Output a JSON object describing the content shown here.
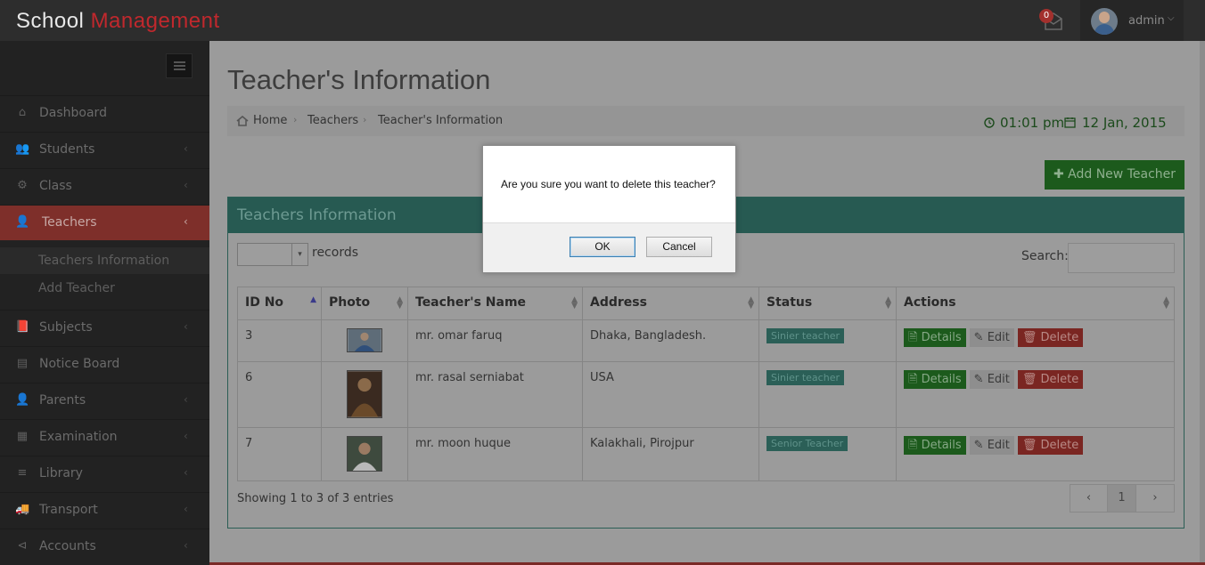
{
  "brand": {
    "part1": "School ",
    "part2": "Management"
  },
  "topbar": {
    "mail_count": "0",
    "user_name": "admin",
    "caret": "⌵"
  },
  "sidebar": {
    "items": [
      {
        "label": "Dashboard",
        "icon": "⌂"
      },
      {
        "label": "Students",
        "icon": "👥"
      },
      {
        "label": "Class",
        "icon": "⚙"
      },
      {
        "label": "Teachers",
        "icon": "👤"
      },
      {
        "label": "Subjects",
        "icon": "📕"
      },
      {
        "label": "Notice Board",
        "icon": "▤"
      },
      {
        "label": "Parents",
        "icon": "👤"
      },
      {
        "label": "Examination",
        "icon": "▦"
      },
      {
        "label": "Library",
        "icon": "≡"
      },
      {
        "label": "Transport",
        "icon": "🚚"
      },
      {
        "label": "Accounts",
        "icon": "⊲"
      }
    ],
    "subitems": [
      {
        "label": "Teachers Information"
      },
      {
        "label": "Add Teacher"
      }
    ],
    "chevron": "‹"
  },
  "page": {
    "title": "Teacher's Information",
    "breadcrumb": [
      "Home",
      "Teachers",
      "Teacher's Information"
    ],
    "time": "01:01 pm",
    "date": "12 Jan, 2015",
    "add_button": "Add New Teacher"
  },
  "panel": {
    "title": "Teachers Information",
    "records_label": "records",
    "search_label": "Search:",
    "columns": [
      "ID No",
      "Photo",
      "Teacher's Name",
      "Address",
      "Status",
      "Actions"
    ],
    "rows": [
      {
        "id": "3",
        "name": "mr. omar faruq",
        "address": "Dhaka, Bangladesh.",
        "status": "Sinier teacher"
      },
      {
        "id": "6",
        "name": "mr. rasal serniabat",
        "address": "USA",
        "status": "Sinier teacher"
      },
      {
        "id": "7",
        "name": "mr. moon huque",
        "address": "Kalakhali, Pirojpur",
        "status": "Senior Teacher"
      }
    ],
    "actions": {
      "details": "Details",
      "edit": "Edit",
      "delete": "Delete"
    },
    "showing": "Showing 1 to 3 of 3 entries",
    "pager": {
      "prev": "‹",
      "page": "1",
      "next": "›"
    }
  },
  "dialog": {
    "message": "Are you sure you want to delete this teacher?",
    "ok": "OK",
    "cancel": "Cancel"
  }
}
